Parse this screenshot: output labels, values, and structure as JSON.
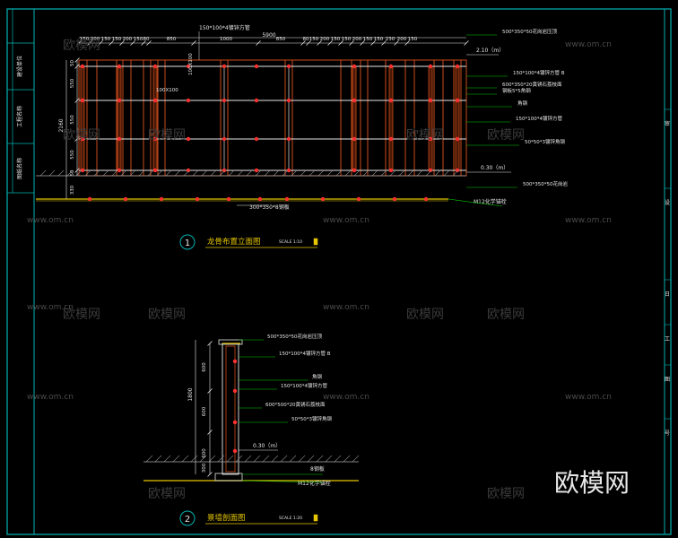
{
  "drawing_1": {
    "title": "龙骨布置立面图",
    "number": "1",
    "scale": "SCALE 1:10",
    "top_overall": "5900",
    "top_dims": [
      "150",
      "200",
      "150",
      "150",
      "200",
      "150",
      "80",
      "850",
      "1000",
      "850",
      "80",
      "150",
      "200",
      "150",
      "150",
      "200",
      "150",
      "150",
      "230",
      "200",
      "150"
    ],
    "left_dims": [
      "50",
      "550",
      "550",
      "550",
      "50"
    ],
    "left_total": "2160",
    "left_bottom": "330",
    "note_top": "150*100*4镀锌方管",
    "note_mid": "100X100",
    "note_center": "100X100",
    "note_bottom": "300*350*8钢板",
    "callouts": [
      "500*350*50花岗岩压顶",
      "150*100*4镀锌方管 B",
      "600*350*20黄锈石荔枝面",
      "钢板5*5角钢",
      "角钢",
      "150*100*4镀锌方管",
      "50*50*3镀锌角钢",
      "500*350*50花岗岩"
    ],
    "level_top": "2.10（m）",
    "level_ground": "0.30（m）",
    "anchor": "M12化学锚栓"
  },
  "drawing_2": {
    "title": "景墙剖面图",
    "number": "2",
    "scale": "SCALE 1:20",
    "left_dims": [
      "600",
      "600",
      "600"
    ],
    "left_total": "1800",
    "left_bottom": "300",
    "callouts": [
      "500*350*50花岗岩压顶",
      "150*100*4镀锌方管 B",
      "角钢",
      "150*100*4镀锌方管",
      "600*500*20黄锈石荔枝面",
      "50*50*3镀锌角钢"
    ],
    "level_ground": "0.30（m）",
    "base": "8钢板",
    "anchor": "M12化学锚栓"
  },
  "title_block": {
    "left_labels": [
      "建设单位",
      "工程名称",
      "图纸名称"
    ],
    "right_labels": [
      "审",
      "设",
      "日",
      "工",
      "图",
      "号"
    ]
  },
  "watermark": {
    "brand": "欧模网",
    "url": "www.om.cn"
  },
  "colors": {
    "background": "#000000",
    "frame": "#00b3b3",
    "steel": "#cc4a1a",
    "dimension": "#e6e6e6",
    "callout": "#00cc00",
    "joint": "#ff3030",
    "accent": "#e6c600"
  }
}
